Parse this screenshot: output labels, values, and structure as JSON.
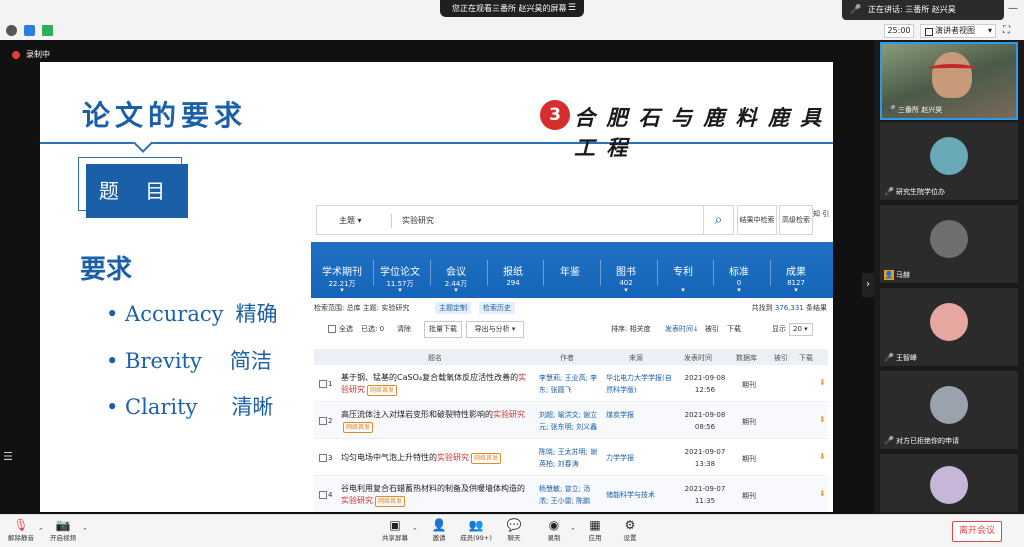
{
  "top": {
    "watching_text": "您正在观看三番所 赵兴昊的屏幕",
    "speaker_text": "正在讲话: 三番所 赵兴昊",
    "window_controls": [
      "—",
      "▢",
      "✕"
    ]
  },
  "bar2": {
    "time": "25:00",
    "view_label": "演讲者视图"
  },
  "recording_label": "录制中",
  "slide": {
    "title": "论文的要求",
    "logo_char": "3",
    "school_name": "合 肥 石 与 鹿 料 鹿 具 工 程",
    "topic_box": "题 目",
    "requirements_heading": "要求",
    "requirements": [
      {
        "en": "• Accuracy",
        "zh": "精确"
      },
      {
        "en": "• Brevity",
        "zh": "简洁"
      },
      {
        "en": "• Clarity",
        "zh": "清晰"
      }
    ]
  },
  "cnki": {
    "search_category": "主题 ▾",
    "search_text": "实验研究",
    "result_search_btn": "结果中检索",
    "advanced_btn": "高级检索",
    "side_text": "知 引",
    "tabs": [
      {
        "label": "学术期刊",
        "count": "22.21万",
        "caret": "▾"
      },
      {
        "label": "学位论文",
        "count": "11.57万",
        "caret": "▾"
      },
      {
        "label": "会议",
        "count": "2.44万",
        "caret": "▾"
      },
      {
        "label": "报纸",
        "count": "294",
        "caret": ""
      },
      {
        "label": "年鉴",
        "count": "",
        "caret": ""
      },
      {
        "label": "图书",
        "count": "402",
        "caret": "▾"
      },
      {
        "label": "专利",
        "count": "",
        "caret": "▾"
      },
      {
        "label": "标准",
        "count": "0",
        "caret": "▾"
      },
      {
        "label": "成果",
        "count": "8127",
        "caret": "▾"
      }
    ],
    "scope_text": "检索范围: 总库  主题: 实验研究",
    "scope_btn1": "主题定制",
    "scope_btn2": "检索历史",
    "found_prefix": "共找到",
    "found_count": "376,331",
    "found_suffix": "条结果",
    "toolbar": {
      "select_all": "全选",
      "selected": "已选: 0",
      "clear": "清除",
      "batch_download": "批量下载",
      "export": "导出与分析 ▾",
      "sort_label": "排序: 相关度",
      "sort_time": "发表时间↓",
      "sort_cited": "被引",
      "sort_download": "下载",
      "show_label": "显示",
      "page_size": "20 ▾"
    },
    "headers": {
      "title": "题名",
      "author": "作者",
      "source": "来源",
      "date": "发表时间",
      "db": "数据库",
      "cited": "被引",
      "download": "下载"
    },
    "rows": [
      {
        "num": "1",
        "title_pre": "基于钢、锰基的CaSO₄复合载氧体反应活性改善的",
        "hl": "实验研究",
        "title_post": "",
        "badge": "网络首发",
        "author": "李慧莉; 王业高; 李东; 张圆飞",
        "source": "华北电力大学学报(自然科学版)",
        "date": "2021-09-08",
        "time": "12:56",
        "db": "期刊",
        "dl": "⬇"
      },
      {
        "num": "2",
        "title_pre": "高压流体注入对煤岩变形和破裂特性影响的",
        "hl": "实验研究",
        "title_post": "",
        "badge": "网络首发",
        "author": "刘超; 喻洪文; 谢立元; 张东明; 刘义鑫",
        "source": "煤炭学报",
        "date": "2021-09-08",
        "time": "08:56",
        "db": "期刊",
        "dl": "⬇"
      },
      {
        "num": "3",
        "title_pre": "均匀电场中气泡上升特性的",
        "hl": "实验研究",
        "title_post": "",
        "badge": "网络首发",
        "author": "陈晓; 王太苏明; 谢英柏; 刘春涛",
        "source": "力学学报",
        "date": "2021-09-07",
        "time": "13:38",
        "db": "期刊",
        "dl": "⬇"
      },
      {
        "num": "4",
        "title_pre": "谷电利用复合石蜡蓄热材料的制备及供暖墙体构造的",
        "hl": "实验研究",
        "title_post": "",
        "badge": "网络首发",
        "author": "杨慧敏; 曾立; 汤浓; 王小雷; 陈鹏",
        "source": "储能科学与技术",
        "date": "2021-09-07",
        "time": "11:35",
        "db": "期刊",
        "dl": "⬇"
      }
    ]
  },
  "participants": [
    {
      "name": "三番所 赵兴昊",
      "type": "video",
      "mic": "on"
    },
    {
      "name": "研究生院学位办",
      "type": "avatar",
      "color": "#6aa9b8",
      "mic": "muted"
    },
    {
      "name": "马赫",
      "type": "avatar",
      "color": "#6e6e6e",
      "mic": "user"
    },
    {
      "name": "王智峰",
      "type": "avatar",
      "color": "#e6a7a0",
      "mic": "muted"
    },
    {
      "name": "对方已拒绝你的申请",
      "type": "avatar",
      "color": "#9aa3ad",
      "mic": "muted"
    },
    {
      "name": "",
      "type": "avatar",
      "color": "#c7b6d8",
      "mic": "none"
    }
  ],
  "bottom_toolbar": [
    {
      "icon": "🎙",
      "label": "解除静音"
    },
    {
      "icon": "📷",
      "label": "开启视频"
    },
    {
      "icon": "▣",
      "label": "共享屏幕"
    },
    {
      "icon": "👤",
      "label": "邀请"
    },
    {
      "icon": "👥",
      "label": "成员(99+)"
    },
    {
      "icon": "💬",
      "label": "聊天"
    },
    {
      "icon": "◉",
      "label": "录制"
    },
    {
      "icon": "▦",
      "label": "应用"
    },
    {
      "icon": "⚙",
      "label": "设置"
    }
  ],
  "leave_label": "离开会议",
  "colors": {
    "brand_blue": "#1a5fa8",
    "tab_blue": "#1565b8",
    "leave_red": "#e04848",
    "highlight_red": "#cc3333"
  }
}
